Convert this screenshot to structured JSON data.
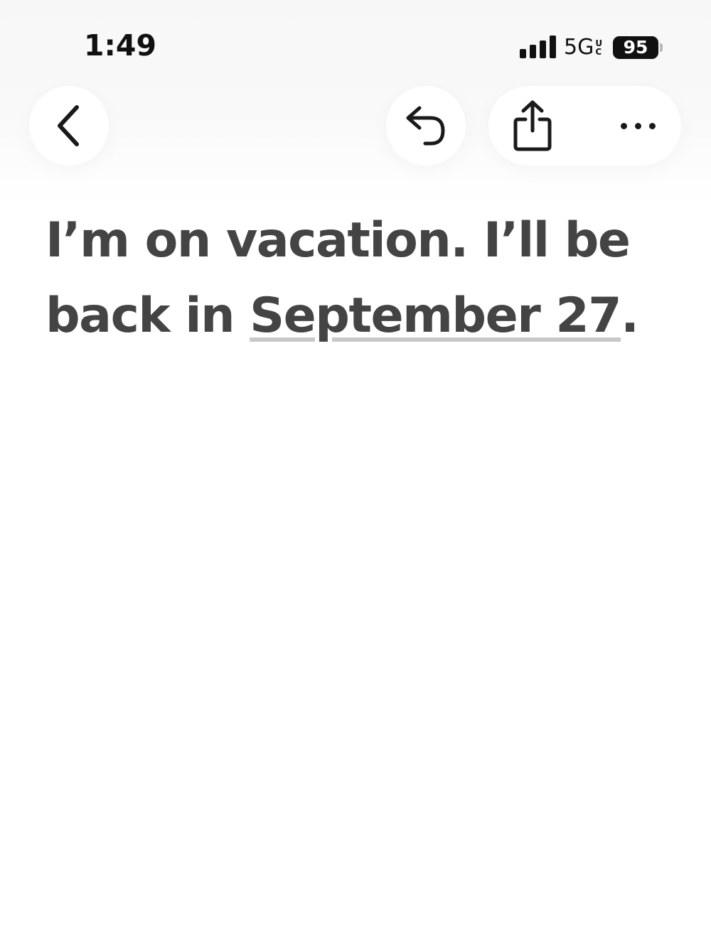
{
  "status_bar": {
    "time": "1:49",
    "network": "5G",
    "network_badge_top": "U",
    "network_badge_bottom": "C",
    "battery": "95",
    "signal_bars": 4
  },
  "toolbar": {
    "back_icon": "chevron-left-icon",
    "reply_icon": "reply-arrow-icon",
    "share_icon": "share-icon",
    "more_icon": "ellipsis-icon"
  },
  "message": {
    "text_before": "I’m on vacation. I’ll be back in ",
    "date_link": "September 27",
    "text_after": "."
  },
  "colors": {
    "text": "#444444",
    "icon": "#1a1a1a",
    "underline": "#c8c8c8",
    "background": "#ffffff"
  }
}
